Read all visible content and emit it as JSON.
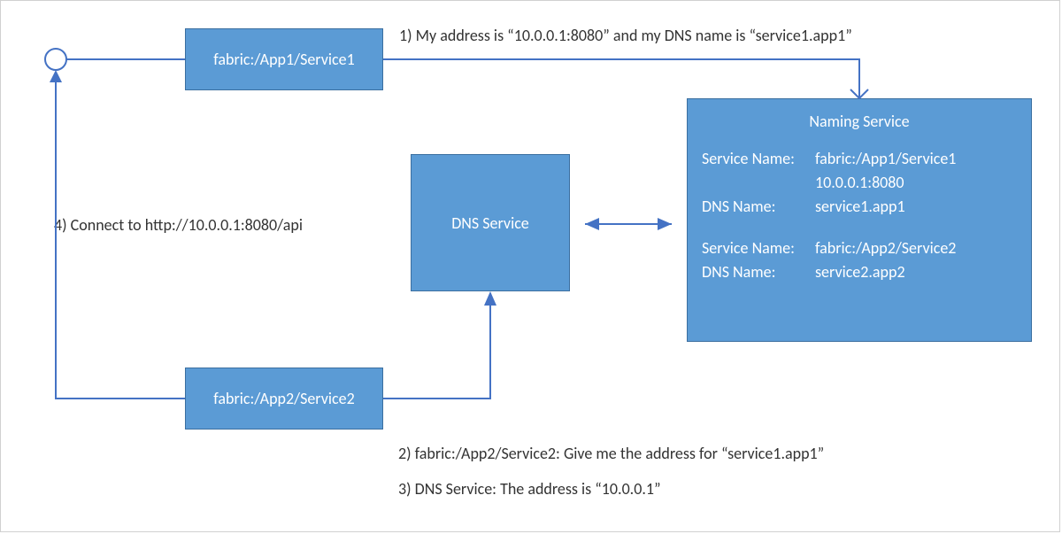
{
  "nodes": {
    "service1": {
      "label": "fabric:/App1/Service1"
    },
    "service2": {
      "label": "fabric:/App2/Service2"
    },
    "dns": {
      "label": "DNS Service"
    },
    "naming": {
      "title": "Naming Service",
      "entries": [
        {
          "service_name": "fabric:/App1/Service1",
          "address": "10.0.0.1:8080",
          "dns_name": "service1.app1"
        },
        {
          "service_name": "fabric:/App2/Service2",
          "dns_name": "service2.app2"
        }
      ]
    }
  },
  "labels": {
    "step1": "1) My address is “10.0.0.1:8080” and my DNS name is “service1.app1”",
    "step2": "2) fabric:/App2/Service2: Give me the address for “service1.app1”",
    "step3": "3) DNS Service: The address is “10.0.0.1”",
    "step4": "4) Connect to http://10.0.0.1:8080/api"
  },
  "kv_labels": {
    "service_name": "Service Name:",
    "dns_name": "DNS Name:"
  },
  "colors": {
    "box_fill": "#5b9bd5",
    "box_border": "#3b6fa0",
    "connector": "#4472c4"
  }
}
